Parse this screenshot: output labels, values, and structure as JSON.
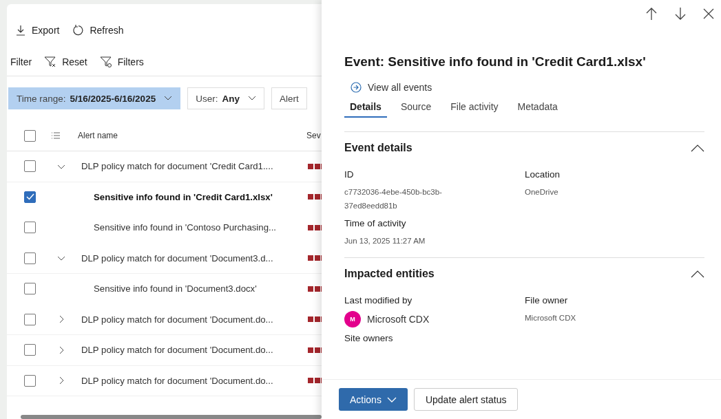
{
  "toolbar": {
    "export": "Export",
    "refresh": "Refresh"
  },
  "filter_bar": {
    "label": "Filter",
    "reset": "Reset",
    "filters": "Filters"
  },
  "filter_chips": [
    {
      "label": "Time range:",
      "value": "5/16/2025-6/16/2025",
      "selected": true
    },
    {
      "label": "User:",
      "value": "Any",
      "selected": false
    },
    {
      "label": "Alert",
      "selected": false
    }
  ],
  "table": {
    "select_all_checked": false,
    "columns": [
      "Alert name",
      "Sev"
    ],
    "rows": [
      {
        "kind": "group",
        "name": "DLP policy match for document 'Credit Card1....",
        "expanded": true,
        "checked": false
      },
      {
        "kind": "child",
        "name": "Sensitive info found in 'Credit Card1.xlsx'",
        "checked": true
      },
      {
        "kind": "child",
        "name": "Sensitive info found in 'Contoso Purchasing...",
        "checked": false
      },
      {
        "kind": "group",
        "name": "DLP policy match for document 'Document3.d...",
        "expanded": true,
        "checked": false
      },
      {
        "kind": "child",
        "name": "Sensitive info found in 'Document3.docx'",
        "checked": false
      },
      {
        "kind": "group",
        "name": "DLP policy match for document 'Document.do...",
        "expanded": false,
        "checked": false
      },
      {
        "kind": "group",
        "name": "DLP policy match for document 'Document.do...",
        "expanded": false,
        "checked": false
      },
      {
        "kind": "group",
        "name": "DLP policy match for document 'Document.do...",
        "expanded": false,
        "checked": false
      }
    ]
  },
  "panel": {
    "title": "Event: Sensitive info found in 'Credit Card1.xlsx'",
    "view_all": "View all events",
    "tabs": [
      {
        "label": "Details",
        "selected": true
      },
      {
        "label": "Source",
        "selected": false
      },
      {
        "label": "File activity",
        "selected": false
      },
      {
        "label": "Metadata",
        "selected": false
      }
    ],
    "sections": [
      {
        "title": "Event details",
        "expanded": true,
        "fields": [
          {
            "label": "ID",
            "value": "c7732036-4ebe-450b-bc3b-37ed8eedd81b"
          },
          {
            "label": "Location",
            "value": "OneDrive"
          },
          {
            "label": "Time of activity",
            "value": "Jun 13, 2025 11:27 AM"
          }
        ]
      },
      {
        "title": "Impacted entities",
        "expanded": true,
        "fields": [
          {
            "label": "Last modified by",
            "value": "Microsoft CDX",
            "avatar": "M",
            "color": "#e3008c"
          },
          {
            "label": "File owner",
            "value": "Microsoft CDX"
          },
          {
            "label": "Site owners"
          }
        ]
      }
    ],
    "actions": "Actions",
    "update_status": "Update alert status"
  }
}
